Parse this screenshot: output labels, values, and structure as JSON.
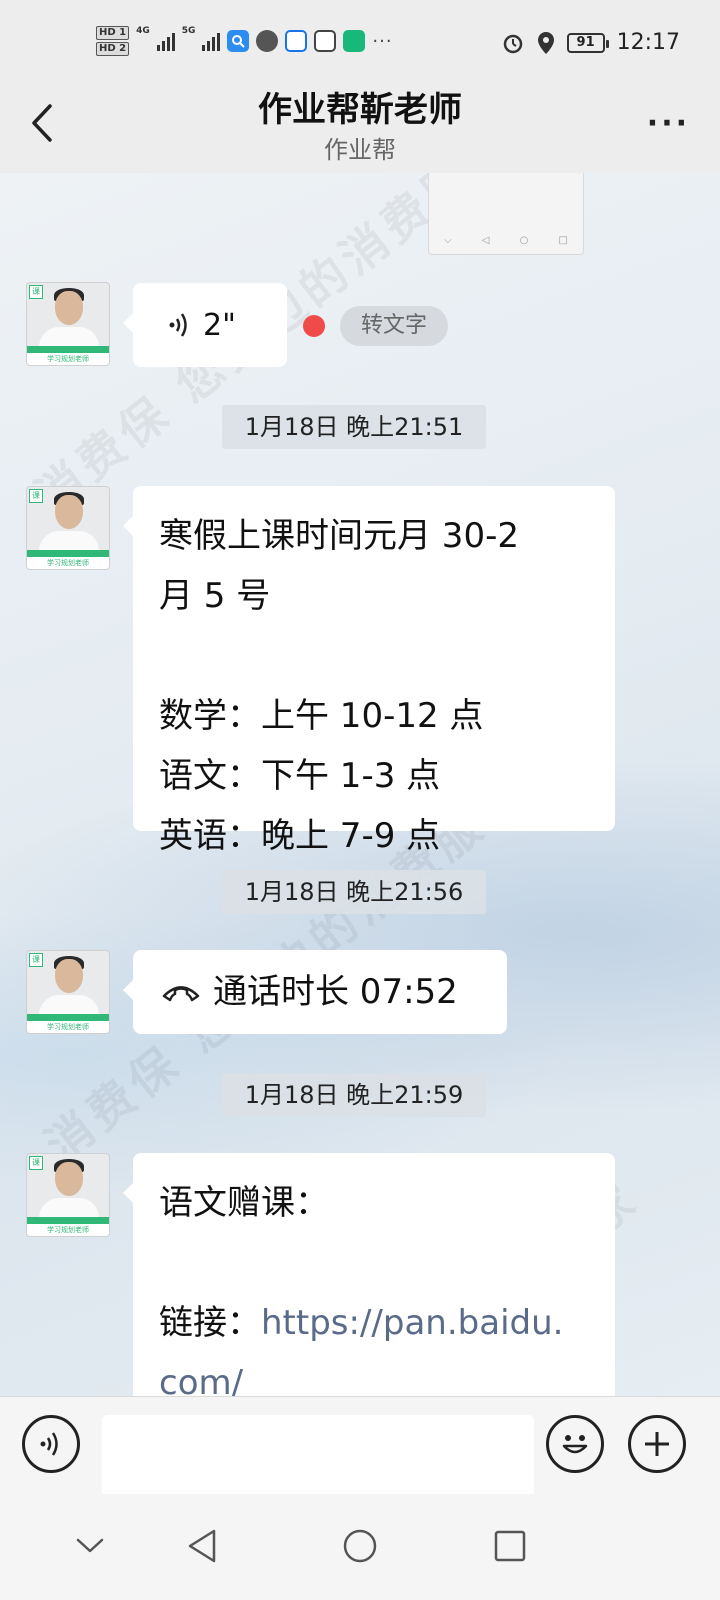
{
  "status_bar": {
    "sim1": "HD 1",
    "sim2": "HD 2",
    "net1": "4G",
    "net2": "5G",
    "battery": "91",
    "time": "12:17"
  },
  "header": {
    "title": "作业帮靳老师",
    "subtitle": "作业帮"
  },
  "watermark_text": "消费保 您身边的消费服务管家",
  "messages": {
    "voice": {
      "duration": "2\"",
      "to_text_label": "转文字"
    },
    "time1": "1月18日 晚上21:51",
    "schedule_lines": [
      "寒假上课时间元月 30-2",
      "月 5 号",
      "",
      "数学：上午 10-12 点",
      "语文：下午 1-3 点",
      "英语：晚上 7-9 点"
    ],
    "time2": "1月18日 晚上21:56",
    "call_text": "通话时长 07:52",
    "time3": "1月18日 晚上21:59",
    "gift_line1": "语文赠课：",
    "gift_link_label": "链接：",
    "gift_link_url_1": "https://pan.baidu.",
    "gift_link_url_2": "com/"
  },
  "avatar_badge": "课",
  "avatar_caption": "学习规划老师",
  "icons": {
    "back": "chevron-left-icon",
    "more": "more-horizontal-icon",
    "voice_input": "voice-wave-icon",
    "emoji": "smiley-icon",
    "plus": "plus-circle-icon"
  }
}
